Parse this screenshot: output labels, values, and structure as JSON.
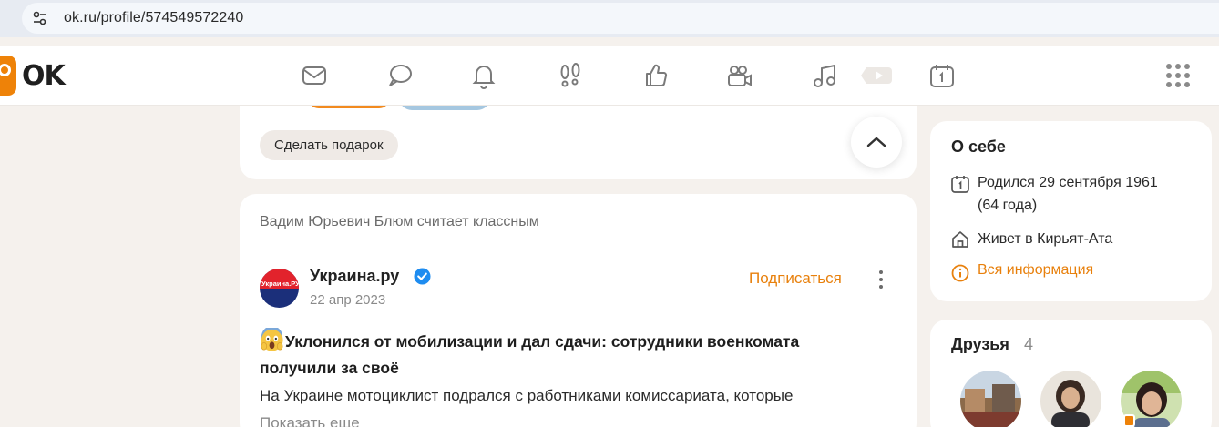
{
  "browser": {
    "url": "ok.ru/profile/574549572240"
  },
  "logo": {
    "text": "OK"
  },
  "nav": {
    "icons": [
      "mail-icon",
      "chat-icon",
      "bell-icon",
      "footprints-icon",
      "thumbs-up-icon",
      "video-camera-icon",
      "music-note-icon",
      "video-play-icon",
      "calendar-icon",
      "apps-grid-icon"
    ]
  },
  "gift": {
    "button_label": "Сделать подарок"
  },
  "feed": {
    "header": "Вадим Юрьевич Блюм считает классным",
    "source_name": "Украина.ру",
    "source_logo_text": "Украина.РУ",
    "date": "22 апр 2023",
    "subscribe_label": "Подписаться",
    "title": "Уклонился от мобилизации и дал сдачи: сотрудники военкомата получили за своё",
    "text": "На Украине мотоциклист подрался с работниками комиссариата, которые",
    "show_more": "Показать еще"
  },
  "about": {
    "title": "О себе",
    "born_line1": "Родился 29 сентября 1961",
    "born_line2": "(64 года)",
    "lives": "Живет в Кирьят-Ата",
    "all_info": "Вся информация"
  },
  "friends": {
    "title": "Друзья",
    "count": "4"
  },
  "colors": {
    "accent": "#ee8208",
    "link_orange": "#e8800c",
    "background": "#f5f1ed",
    "verified_blue": "#1e8cf0"
  }
}
